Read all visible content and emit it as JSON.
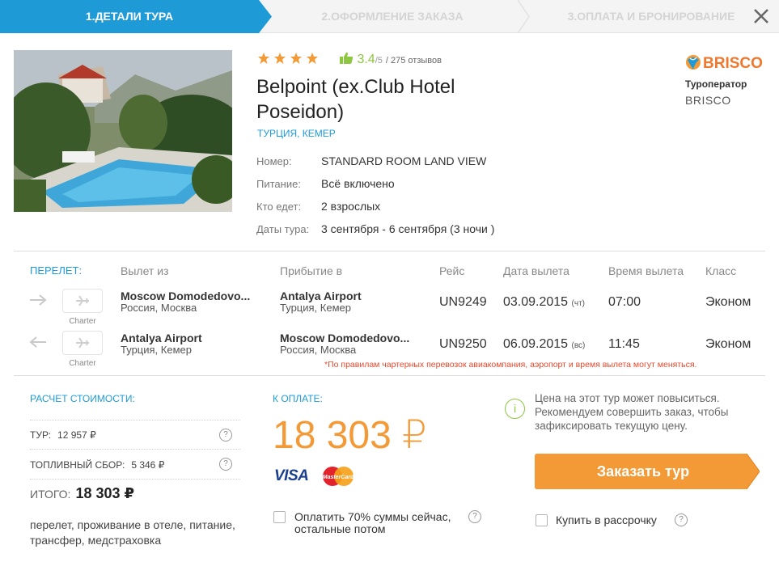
{
  "steps": [
    "1.ДЕТАЛИ ТУРА",
    "2.ОФОРМЛЕНИЕ ЗАКАЗА",
    "3.ОПЛАТА И БРОНИРОВАНИЕ"
  ],
  "hotel": {
    "stars": 4,
    "rating": "3.4",
    "rating_max": "/5",
    "reviews": "/ 275 отзывов",
    "name": "Belpoint (ex.Club Hotel Poseidon)",
    "location": "ТУРЦИЯ, КЕМЕР",
    "details": [
      {
        "label": "Номер:",
        "value": "STANDARD ROOM LAND VIEW"
      },
      {
        "label": "Питание:",
        "value": "Всё включено"
      },
      {
        "label": "Кто едет:",
        "value": "2 взрослых"
      },
      {
        "label": "Даты тура:",
        "value": "3 сентября - 6 сентября (3 ночи )"
      }
    ]
  },
  "operator": {
    "logo_text": "BRISCO",
    "title": "Туроператор",
    "name": "BRISCO"
  },
  "flights": {
    "section_label": "ПЕРЕЛЕТ:",
    "headers": {
      "from": "Вылет из",
      "to": "Прибытие в",
      "flight": "Рейс",
      "date": "Дата вылета",
      "time": "Время вылета",
      "class": "Класс"
    },
    "rows": [
      {
        "charter": "Charter",
        "from_name": "Moscow Domodedovo...",
        "from_sub": "Россия, Москва",
        "to_name": "Antalya Airport",
        "to_sub": "Турция, Кемер",
        "flight": "UN9249",
        "date": "03.09.2015",
        "weekday": "(чт)",
        "time": "07:00",
        "class": "Эконом"
      },
      {
        "charter": "Charter",
        "from_name": "Antalya Airport",
        "from_sub": "Турция, Кемер",
        "to_name": "Moscow Domodedovo...",
        "to_sub": "Россия, Москва",
        "flight": "UN9250",
        "date": "06.09.2015",
        "weekday": "(вс)",
        "time": "11:45",
        "class": "Эконом"
      }
    ],
    "note": "*По правилам чартерных перевозок авиакомпания, аэропорт и время вылета могут меняться."
  },
  "calc": {
    "title": "РАСЧЕТ СТОИМОСТИ:",
    "tour_label": "ТУР:",
    "tour_value": "12 957 ₽",
    "fuel_label": "ТОПЛИВНЫЙ СБОР:",
    "fuel_value": "5 346 ₽",
    "total_label": "ИТОГО:",
    "total_value": "18 303 ₽",
    "includes": "перелет, проживание в отеле, питание, трансфер, медстраховка"
  },
  "payment": {
    "title": "К ОПЛАТЕ:",
    "amount": "18 303 ₽",
    "visa": "VISA",
    "mastercard": "MasterCard",
    "partial_label": "Оплатить 70% суммы сейчас, остальные потом",
    "installment_label": "Купить в рассрочку",
    "warning": "Цена на этот тур может повыситься. Рекомендуем совершить заказ, чтобы зафиксировать текущую цену.",
    "order_button": "Заказать тур"
  },
  "colors": {
    "accent": "#1e9bd7",
    "price": "#f39a36",
    "green": "#8dc63f",
    "note": "#e8482c"
  }
}
